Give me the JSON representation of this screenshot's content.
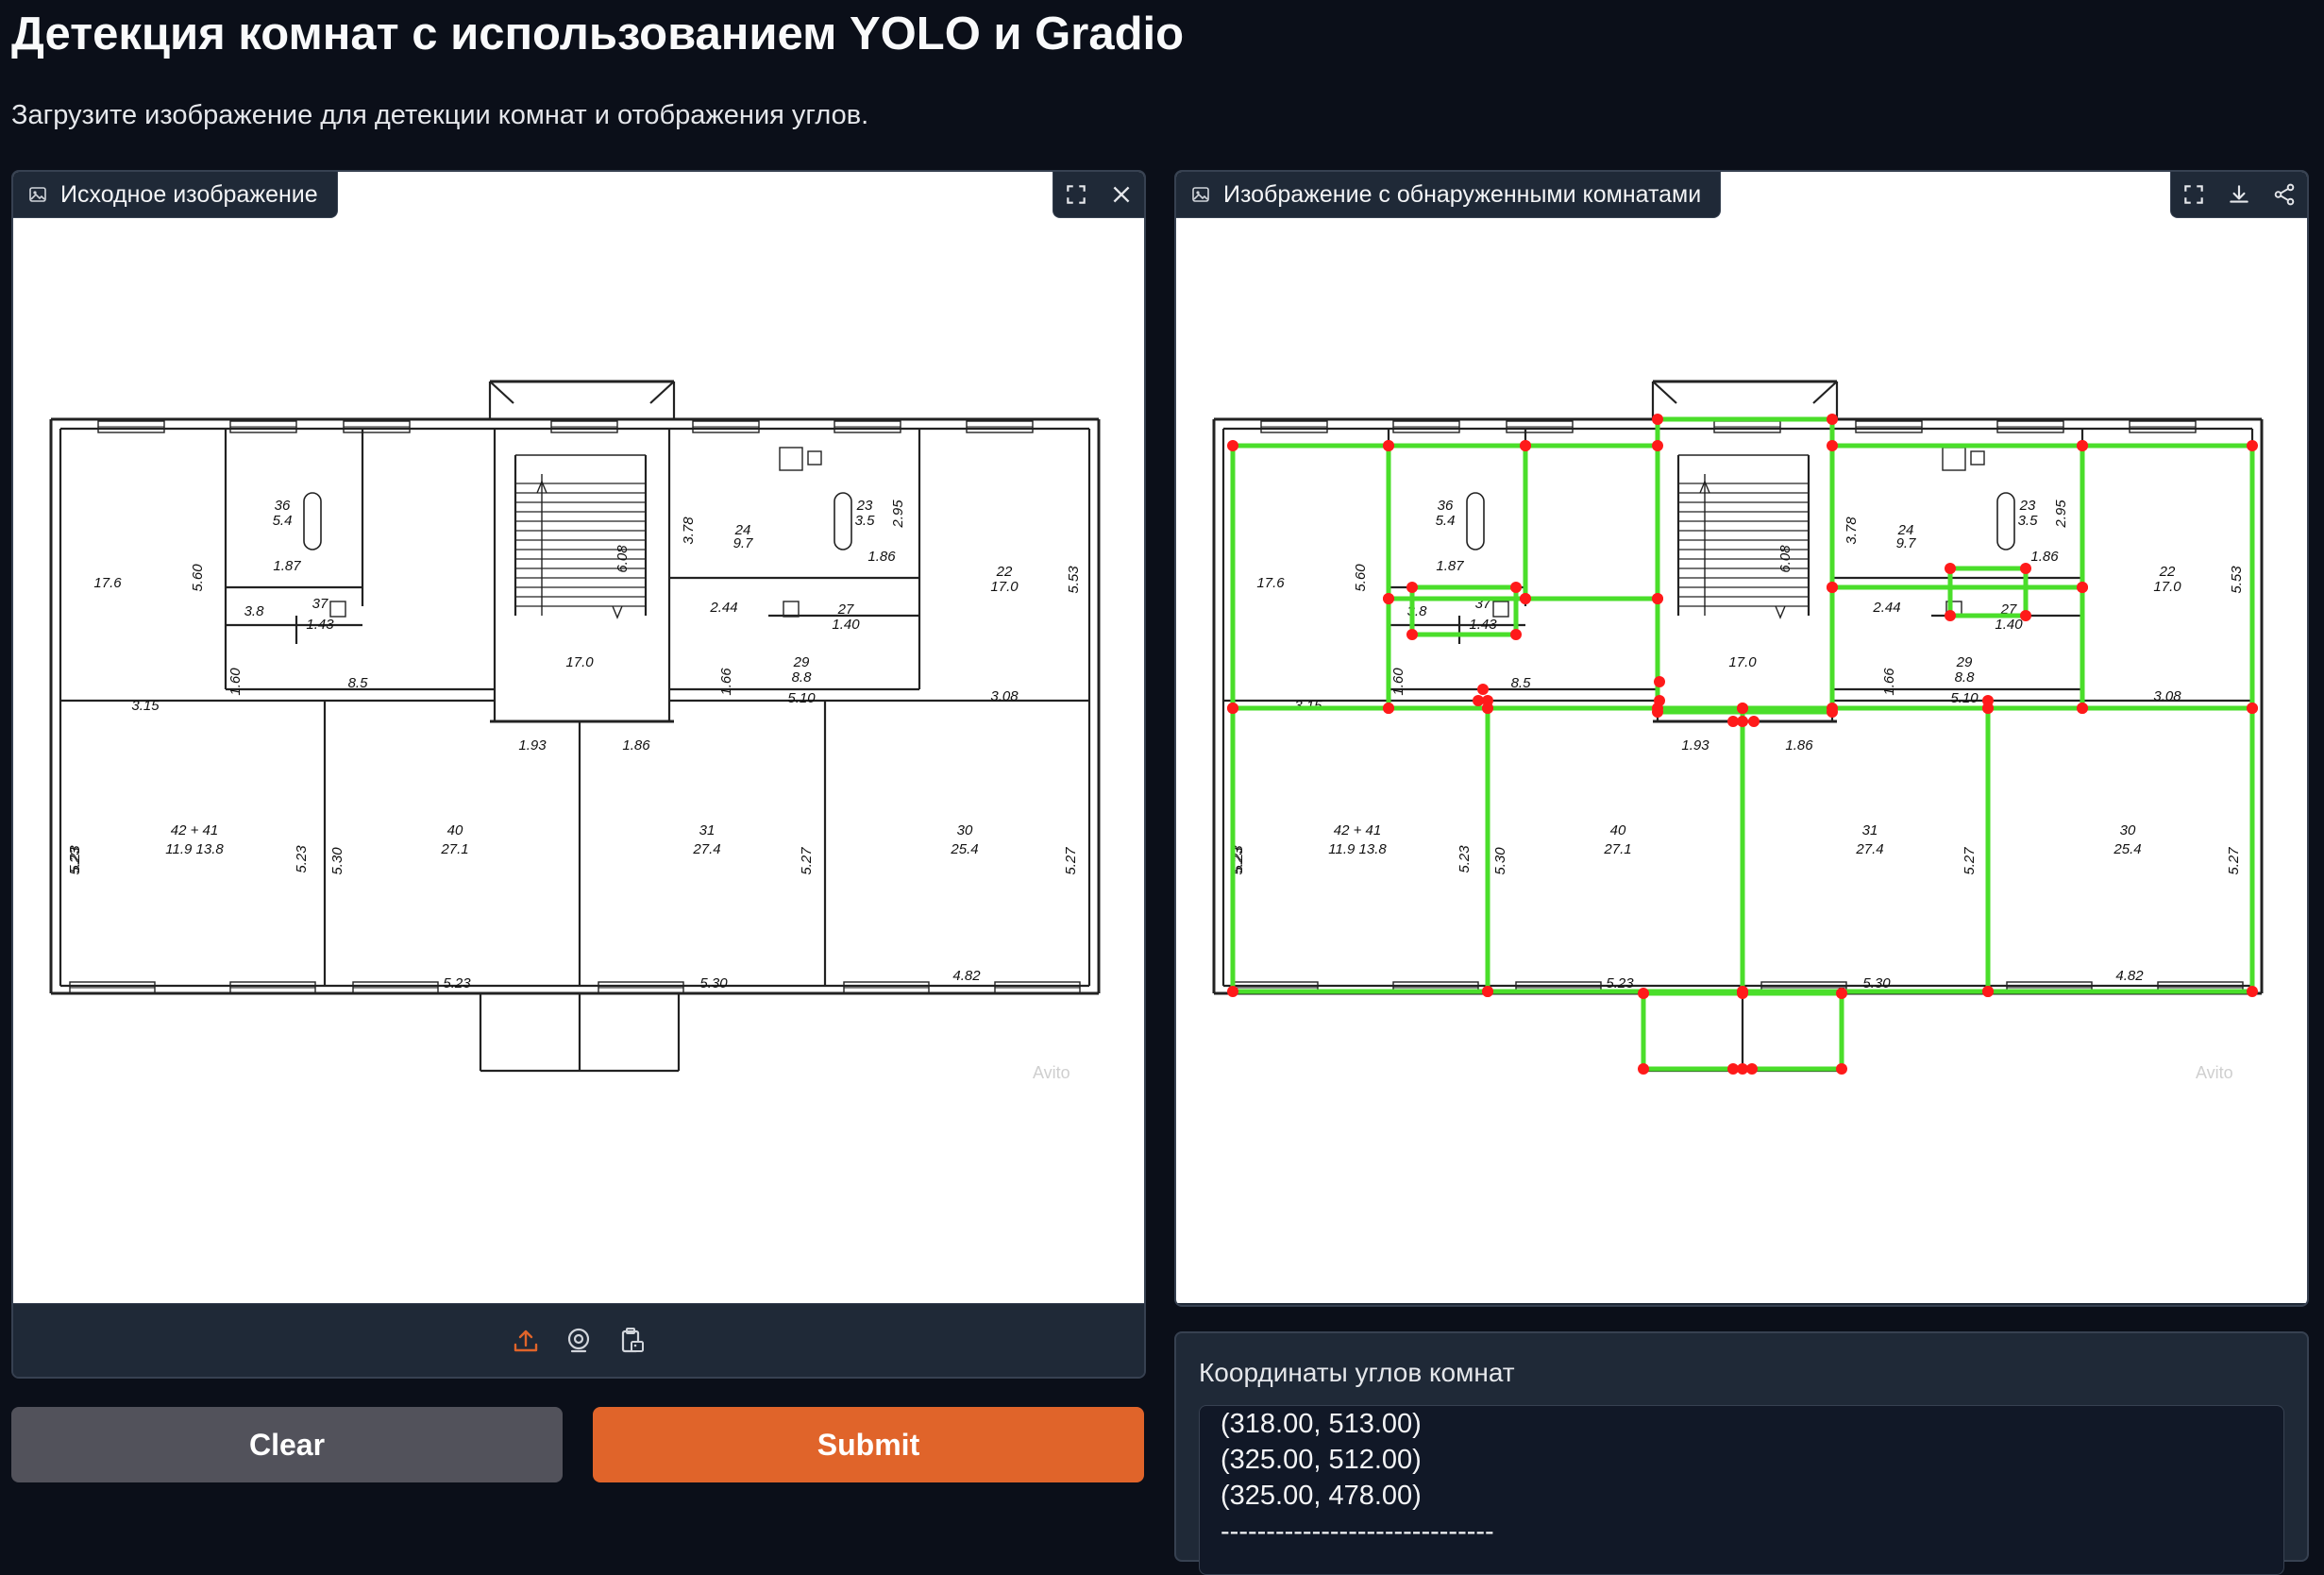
{
  "page": {
    "title": "Детекция комнат с использованием YOLO и Gradio",
    "subtitle": "Загрузите изображение для детекции комнат и отображения углов."
  },
  "input_panel": {
    "label": "Исходное изображение",
    "icons": [
      "image-icon",
      "fullscreen-icon",
      "close-icon",
      "upload-icon",
      "webcam-icon",
      "clipboard-icon"
    ],
    "watermark": "Avito"
  },
  "output_panel": {
    "label": "Изображение с обнаруженными комнатами",
    "icons": [
      "image-icon",
      "fullscreen-icon",
      "download-icon",
      "share-icon"
    ],
    "watermark": "Avito"
  },
  "buttons": {
    "clear": "Clear",
    "submit": "Submit"
  },
  "coords": {
    "label": "Координаты углов комнат",
    "lines": [
      "(318.00, 513.00)",
      "(325.00, 512.00)",
      "(325.00, 478.00)",
      "------------------------------"
    ]
  },
  "floorplan": {
    "labels": [
      {
        "text": "17.6"
      },
      {
        "text": "5.60"
      },
      {
        "text": "36"
      },
      {
        "text": "5.4"
      },
      {
        "text": "1.87"
      },
      {
        "text": "3.8"
      },
      {
        "text": "37"
      },
      {
        "text": "1.43"
      },
      {
        "text": "6.08"
      },
      {
        "text": "17.0"
      },
      {
        "text": "3.78"
      },
      {
        "text": "24"
      },
      {
        "text": "9.7"
      },
      {
        "text": "23"
      },
      {
        "text": "3.5"
      },
      {
        "text": "2.95"
      },
      {
        "text": "1.86"
      },
      {
        "text": "2.44"
      },
      {
        "text": "27"
      },
      {
        "text": "1.40"
      },
      {
        "text": "22"
      },
      {
        "text": "17.0"
      },
      {
        "text": "5.53"
      },
      {
        "text": "1.60"
      },
      {
        "text": "8.5"
      },
      {
        "text": "1.66"
      },
      {
        "text": "29"
      },
      {
        "text": "8.8"
      },
      {
        "text": "5.10"
      },
      {
        "text": "3.08"
      },
      {
        "text": "3.15"
      },
      {
        "text": "1.93"
      },
      {
        "text": "1.86"
      },
      {
        "text": "42 + 41"
      },
      {
        "text": "11.9   13.8"
      },
      {
        "text": "5.23"
      },
      {
        "text": "5.23"
      },
      {
        "text": "5.30"
      },
      {
        "text": "40"
      },
      {
        "text": "27.1"
      },
      {
        "text": "31"
      },
      {
        "text": "27.4"
      },
      {
        "text": "5.27"
      },
      {
        "text": "30"
      },
      {
        "text": "25.4"
      },
      {
        "text": "5.27"
      },
      {
        "text": "5.23"
      },
      {
        "text": "5.30"
      },
      {
        "text": "4.82"
      },
      {
        "text": "5.23"
      }
    ]
  },
  "colors": {
    "accent": "#e0642a",
    "detection_box": "#4ade2a",
    "corner_point": "#ff1a1a"
  }
}
